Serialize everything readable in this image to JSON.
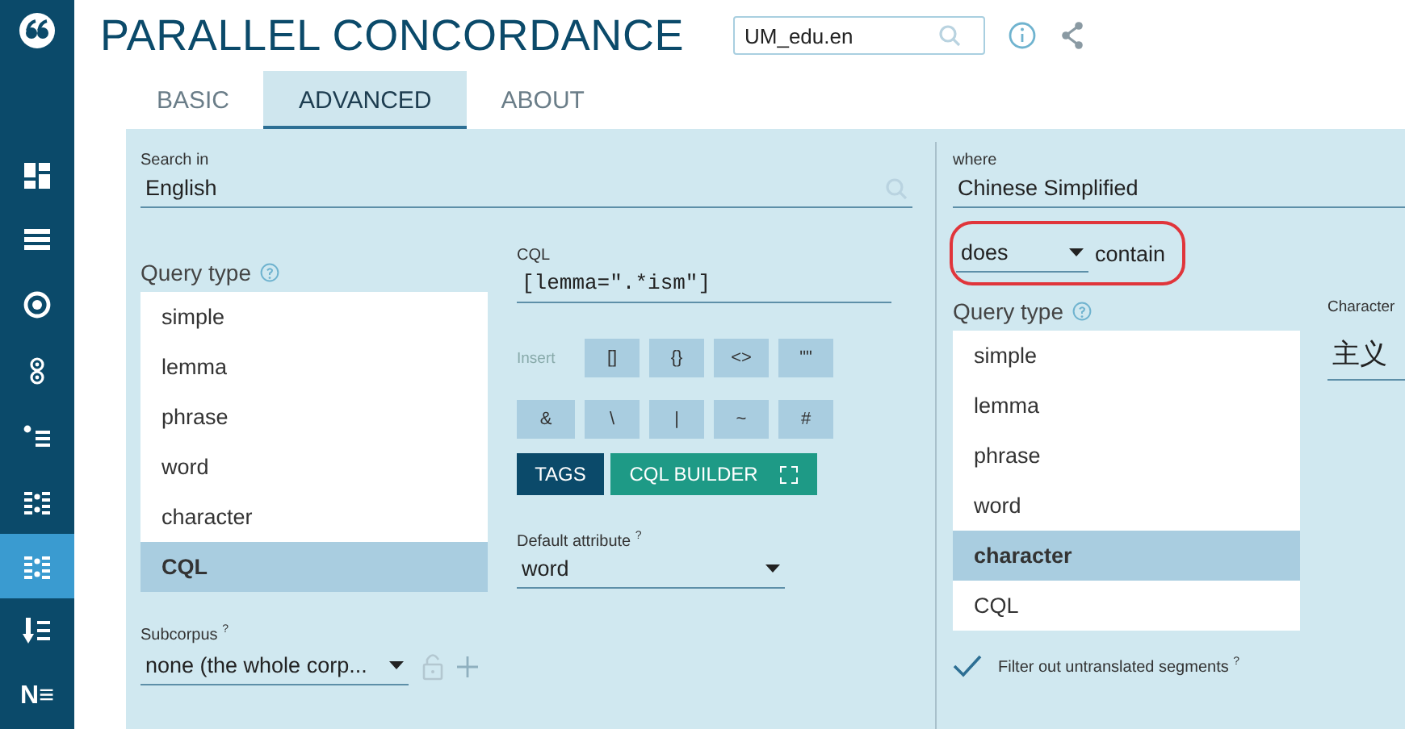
{
  "sidebar": {
    "items": [
      {
        "kind": "logo",
        "selected": false
      },
      {
        "kind": "dashboard",
        "selected": false
      },
      {
        "kind": "list",
        "selected": false
      },
      {
        "kind": "target",
        "selected": false
      },
      {
        "kind": "rings",
        "selected": false
      },
      {
        "kind": "dot-list",
        "selected": false
      },
      {
        "kind": "dots-grid",
        "selected": false
      },
      {
        "kind": "dots-grid",
        "selected": true
      },
      {
        "kind": "sort-list",
        "selected": false
      },
      {
        "kind": "text",
        "glyph": "N≡",
        "selected": false
      }
    ]
  },
  "header": {
    "title": "PARALLEL CONCORDANCE",
    "corpus_field": {
      "value": "UM_edu.en"
    }
  },
  "tabs": [
    {
      "label": "BASIC",
      "selected": false
    },
    {
      "label": "ADVANCED",
      "selected": true
    },
    {
      "label": "ABOUT",
      "selected": false
    }
  ],
  "search_in": {
    "label": "Search in",
    "value": "English"
  },
  "query_type": {
    "label": "Query type",
    "options": [
      {
        "label": "simple",
        "selected": false
      },
      {
        "label": "lemma",
        "selected": false
      },
      {
        "label": "phrase",
        "selected": false
      },
      {
        "label": "word",
        "selected": false
      },
      {
        "label": "character",
        "selected": false
      },
      {
        "label": "CQL",
        "selected": true
      }
    ]
  },
  "cql": {
    "label": "CQL",
    "value": "[lemma=\".*ism\"]"
  },
  "insert": {
    "label": "Insert",
    "buttons": [
      "[]",
      "{}",
      "<>",
      "\"\"",
      "&",
      "\\",
      "|",
      "~",
      "#"
    ]
  },
  "tags_button": "TAGS",
  "cql_builder_button": "CQL BUILDER",
  "default_attribute": {
    "label": "Default attribute",
    "hint": "?",
    "value": "word"
  },
  "subcorpus": {
    "label": "Subcorpus",
    "hint": "?",
    "value": "none (the whole corp..."
  },
  "where": {
    "label": "where",
    "value": "Chinese Simplified",
    "condition": {
      "value": "does",
      "suffix": "contain",
      "highlighted": true
    },
    "query_type": {
      "label": "Query type",
      "options": [
        {
          "label": "simple",
          "selected": false
        },
        {
          "label": "lemma",
          "selected": false
        },
        {
          "label": "phrase",
          "selected": false
        },
        {
          "label": "word",
          "selected": false
        },
        {
          "label": "character",
          "selected": true
        },
        {
          "label": "CQL",
          "selected": false
        }
      ]
    },
    "character": {
      "label": "Character",
      "value": "主义"
    },
    "filter": {
      "label": "Filter out untranslated segments",
      "hint": "?",
      "checked": true
    }
  }
}
